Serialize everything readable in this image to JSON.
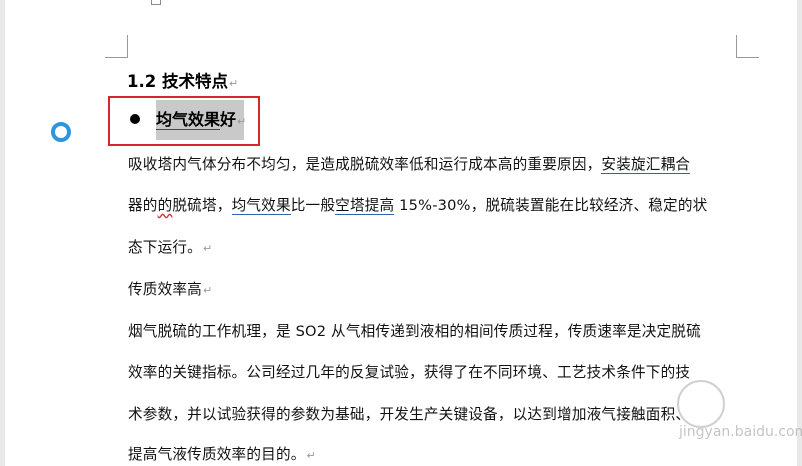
{
  "heading": "1.2  技术特点",
  "paragraph_mark": "↵",
  "bullet": {
    "part_underlined": "均气效果",
    "part_plain": "好"
  },
  "body": {
    "line1_pre": "吸收塔内气体分布不均匀，是造成脱硫效率低和运行成本高的重要原因，",
    "line1_link": "安装旋汇耦合",
    "line2_pre": "器的",
    "line2_wavy": "的",
    "line2_a": "脱硫塔，",
    "line2_u1": "均气效果",
    "line2_b": "比一般",
    "line2_u2": "空塔提高",
    "line2_c": " 15%-30%，脱硫装置能在比较经济、稳定的状",
    "line3": "态下运行。",
    "line4": "传质效率高",
    "line5": "烟气脱硫的工作机理，是 SO2 从气相传递到液相的相间传质过程，传质速率是决定脱硫",
    "line6": "效率的关键指标。公司经过几年的反复试验，获得了在不同环境、工艺技术条件下的技",
    "line7": "术参数，并以试验获得的参数为基础，开发生产关键设备，以达到增加液气接触面积、",
    "line8": "提高气液传质效率的目的。"
  },
  "watermark": {
    "text": "jingyan.baidu.com"
  }
}
